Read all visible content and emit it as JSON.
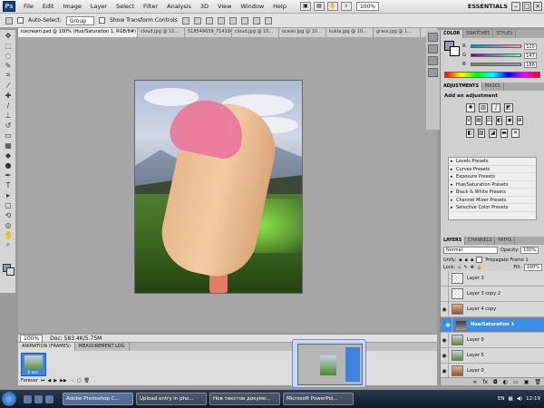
{
  "menubar": {
    "logo": "Ps",
    "menus": [
      "File",
      "Edit",
      "Image",
      "Layer",
      "Select",
      "Filter",
      "Analysis",
      "3D",
      "View",
      "Window",
      "Help"
    ],
    "zoom": "100%",
    "workspace": "ESSENTIALS"
  },
  "options": {
    "auto_select_label": "Auto-Select:",
    "auto_select_value": "Group",
    "show_transform_label": "Show Transform Controls"
  },
  "document_tabs": [
    "icecream.psd @ 100% (Hue/Saturation 1, RGB/8#) *",
    "cloud.jpg @ 10...",
    "518549639_7141840016...",
    "cloud.jpg @ 10...",
    "ocean.jpg @ 10...",
    "kukla.jpg @ 10...",
    "grass.jpg @ 1..."
  ],
  "status": {
    "zoom": "100%",
    "doc": "Doc: 583.4K/5.75M"
  },
  "animation": {
    "tabs": [
      "ANIMATION (FRAMES)",
      "MEASUREMENT LOG"
    ],
    "frame_delay": "0 sec.",
    "loop": "Forever"
  },
  "color_panel": {
    "tabs": [
      "COLOR",
      "SWATCHES",
      "STYLES"
    ],
    "channels": [
      {
        "label": "R",
        "value": "120"
      },
      {
        "label": "G",
        "value": "147"
      },
      {
        "label": "B",
        "value": "186"
      }
    ],
    "foreground_color": "#7893ba"
  },
  "adjustments": {
    "tabs": [
      "ADJUSTMENTS",
      "MASKS"
    ],
    "title": "Add an adjustment",
    "presets": [
      "Levels Presets",
      "Curves Presets",
      "Exposure Presets",
      "Hue/Saturation Presets",
      "Black & White Presets",
      "Channel Mixer Presets",
      "Selective Color Presets"
    ]
  },
  "layers_panel": {
    "tabs": [
      "LAYERS",
      "CHANNELS",
      "PATHS"
    ],
    "blend_mode": "Normal",
    "opacity_label": "Opacity:",
    "opacity": "100%",
    "unify_label": "Unify:",
    "propagate_label": "Propagate Frame 1",
    "lock_label": "Lock:",
    "fill_label": "Fill:",
    "fill": "100%",
    "layers": [
      {
        "name": "Layer 3",
        "visible": false,
        "thumb": "checker"
      },
      {
        "name": "Layer 3 copy 2",
        "visible": false,
        "thumb": "checker"
      },
      {
        "name": "Layer 4 copy",
        "visible": true,
        "thumb": "face"
      },
      {
        "name": "Hue/Saturation 1",
        "visible": true,
        "thumb": "adj",
        "selected": true
      },
      {
        "name": "Layer 9",
        "visible": true,
        "thumb": "photo"
      },
      {
        "name": "Layer 5",
        "visible": true,
        "thumb": "photo"
      },
      {
        "name": "Layer 0",
        "visible": true,
        "thumb": "face"
      }
    ]
  },
  "taskbar": {
    "tasks": [
      "Adobe Photoshop C...",
      "Upload entry in pho...",
      "Нов текстов докуме...",
      "Microsoft PowerPoi..."
    ],
    "language": "EN",
    "clock": "12:19"
  }
}
